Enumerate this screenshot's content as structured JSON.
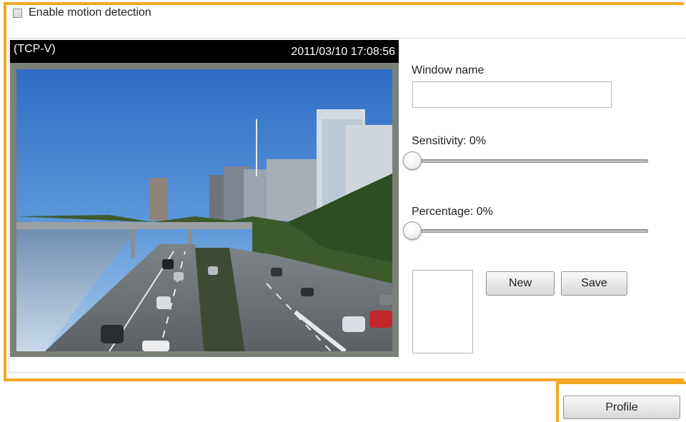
{
  "motion": {
    "enable_label": "Enable motion detection",
    "enabled": false
  },
  "video": {
    "stream_name": "(TCP-V)",
    "timestamp": "2011/03/10  17:08:56"
  },
  "window_settings": {
    "window_name_label": "Window name",
    "window_name_value": "",
    "sensitivity_label": "Sensitivity: 0%",
    "sensitivity_value": 0,
    "percentage_label": "Percentage: 0%",
    "percentage_value": 0
  },
  "buttons": {
    "new_label": "New",
    "save_label": "Save",
    "profile_label": "Profile"
  },
  "colors": {
    "highlight": "#f5a623",
    "video_header_bg": "#000000",
    "video_frame": "#7b8079"
  },
  "icons": {
    "checkbox": "unchecked-checkbox-icon",
    "slider_handle": "slider-handle-icon"
  }
}
